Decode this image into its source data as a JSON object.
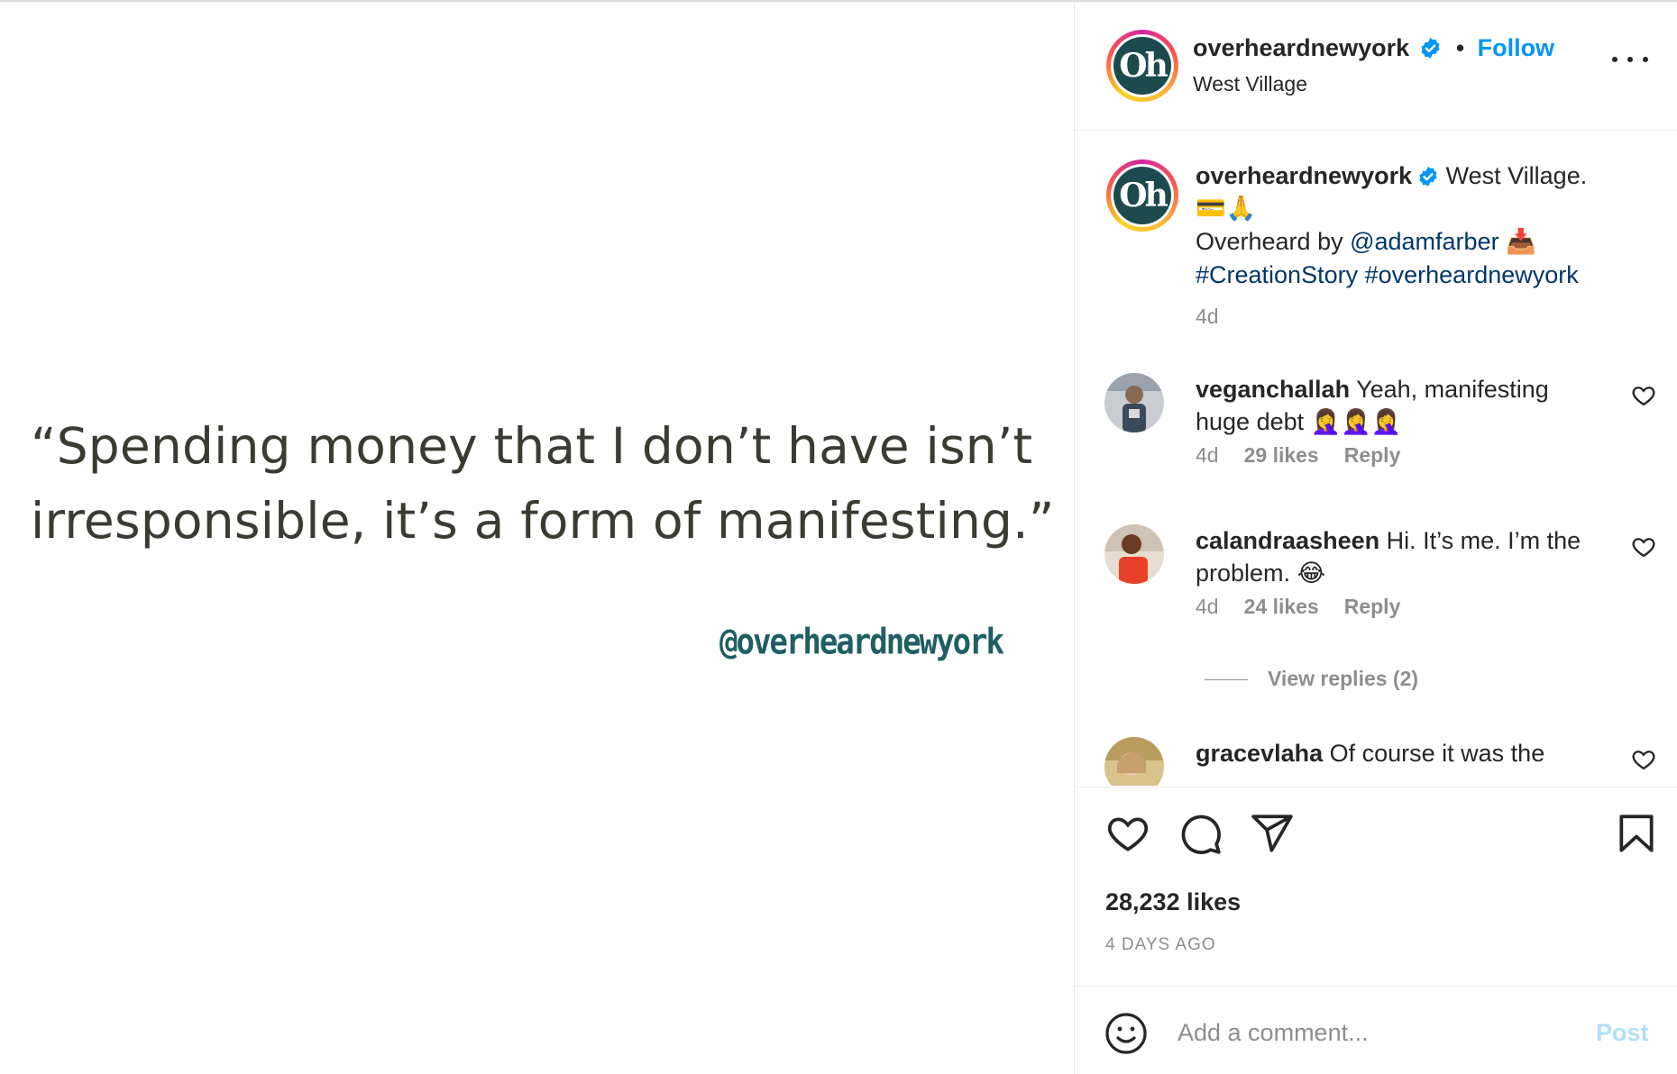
{
  "post": {
    "quote_line1": "“Spending money that I don’t have isn’t",
    "quote_line2": "irresponsible, it’s a form of manifesting.”",
    "watermark": "@overheardnewyork"
  },
  "header": {
    "username": "overheardnewyork",
    "separator": "•",
    "follow_label": "Follow",
    "location": "West Village",
    "avatar_text": "Oh"
  },
  "caption": {
    "username": "overheardnewyork",
    "text1": "West Village.",
    "emojis1": "💳🙏",
    "text2": "Overheard by ",
    "mention": "@adamfarber",
    "emoji2": "📥",
    "hashtag1": "#CreationStory",
    "hashtag2": "#overheardnewyork",
    "time": "4d"
  },
  "comments": [
    {
      "username": "veganchallah",
      "text": "Yeah, manifesting huge debt",
      "emojis": "🤦‍♀️🤦‍♀️🤦‍♀️",
      "time": "4d",
      "likes": "29 likes",
      "reply": "Reply"
    },
    {
      "username": "calandraasheen",
      "text": "Hi. It’s me. I’m the problem.",
      "emojis": "😂",
      "time": "4d",
      "likes": "24 likes",
      "reply": "Reply"
    },
    {
      "username": "gracevlaha",
      "text": "Of course it was the"
    }
  ],
  "view_replies": "View replies (2)",
  "actions": {
    "likes": "28,232 likes",
    "time_ago": "4 DAYS AGO"
  },
  "add_comment": {
    "placeholder": "Add a comment...",
    "post_label": "Post"
  },
  "colors": {
    "accent": "#0095f6",
    "link": "#00376b",
    "muted": "#8e8e8e",
    "post_disabled": "#b2dffc",
    "brand_logo_bg": "#1c4a4d",
    "watermark": "#1f5f63"
  },
  "icons": [
    "verified-badge-icon",
    "more-options-icon",
    "heart-icon",
    "comment-icon",
    "share-icon",
    "bookmark-icon",
    "emoji-icon"
  ]
}
